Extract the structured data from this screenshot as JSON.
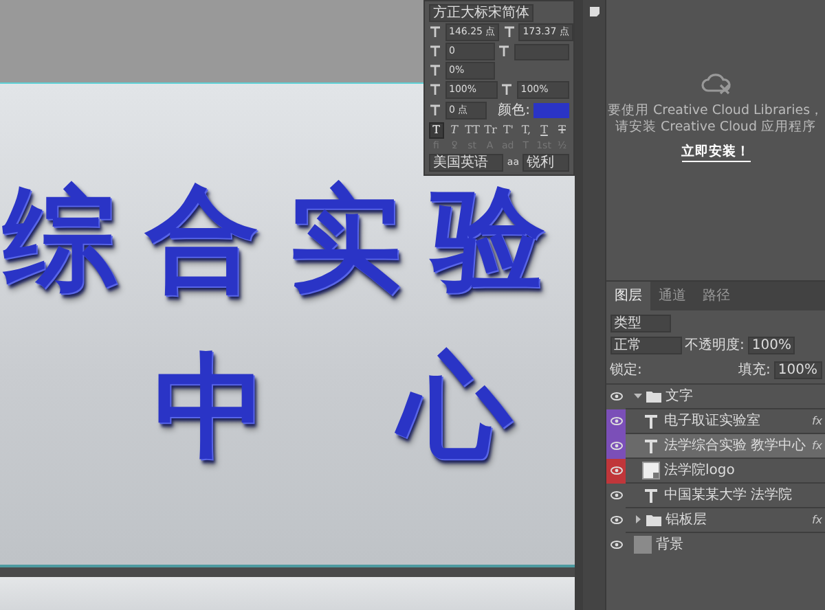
{
  "plate": {
    "line_1": [
      "综",
      "合",
      "实",
      "验"
    ],
    "line_2": [
      "中",
      "心"
    ]
  },
  "character_panel": {
    "font_family": "方正大标宋简体",
    "font_size": "146.25 点",
    "leading": "173.37 点",
    "kerning": "0",
    "tsume": "0%",
    "vertical_scale": "100%",
    "horizontal_scale": "100%",
    "baseline_shift": "0 点",
    "color_label": "颜色:",
    "color": "#2a34c6",
    "style_buttons": [
      {
        "label": "T",
        "selected": true
      },
      {
        "label": "T",
        "selected": false
      },
      {
        "label": "TT",
        "selected": false
      },
      {
        "label": "Tr",
        "selected": false
      },
      {
        "label": "T'",
        "selected": false
      },
      {
        "label": "T,",
        "selected": false
      },
      {
        "label": "T",
        "selected": false
      },
      {
        "label": "T",
        "selected": false
      }
    ],
    "opentype_buttons": [
      "fi",
      "ꝿ",
      "st",
      "A",
      "ad",
      "T",
      "1st",
      "½"
    ],
    "language": "美国英语",
    "aa_label": "aa",
    "anti_alias": "锐利"
  },
  "libraries_panel": {
    "message_1": "要使用 Creative Cloud Libraries，",
    "message_2": "请安装 Creative Cloud 应用程序",
    "install_link": "立即安装！"
  },
  "layers_panel": {
    "tabs": [
      {
        "label": "图层",
        "selected": true
      },
      {
        "label": "通道",
        "selected": false
      },
      {
        "label": "路径",
        "selected": false
      }
    ],
    "filter": "类型",
    "blend_mode": "正常",
    "opacity_label": "不透明度:",
    "opacity": "100%",
    "lock_label": "锁定:",
    "fill_label": "填充:",
    "fill": "100%",
    "layers": [
      {
        "kind": "group",
        "name": "文字",
        "expanded": true,
        "selected": false,
        "children": [
          {
            "kind": "text",
            "name": "电子取证实验室",
            "selected": false,
            "fx": "fx",
            "color": "#7b4fb8"
          },
          {
            "kind": "text",
            "name": "法学综合实验 教学中心",
            "selected": true,
            "fx": "fx",
            "color": "#7b4fb8"
          },
          {
            "kind": "image",
            "name": "法学院logo",
            "selected": false,
            "color": "#c0363a"
          },
          {
            "kind": "text",
            "name": "中国某某大学 法学院",
            "selected": false
          }
        ]
      },
      {
        "kind": "group",
        "name": "铝板层",
        "expanded": false,
        "selected": false,
        "fx": "fx"
      },
      {
        "kind": "fill",
        "name": "背景",
        "selected": false
      }
    ]
  }
}
